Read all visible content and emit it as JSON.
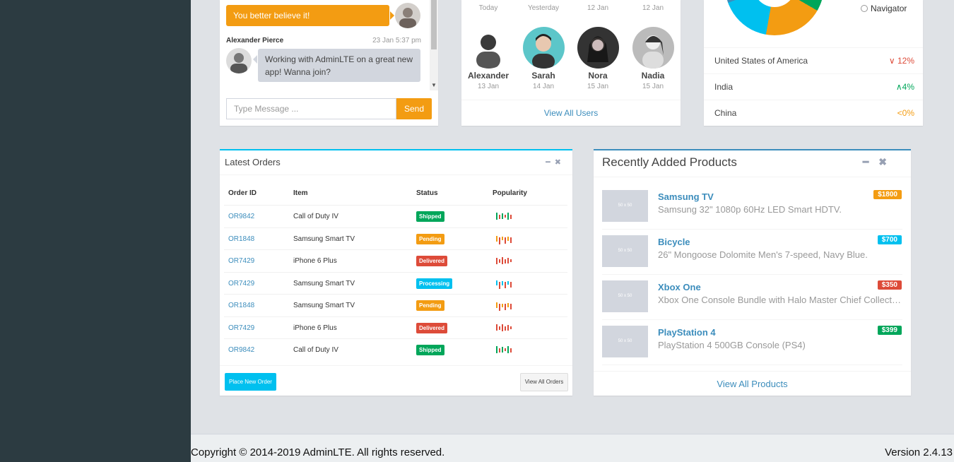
{
  "colors": {
    "sidebar": "#2c3b41",
    "orange": "#f39c12",
    "green": "#00a65a",
    "red": "#dd4b39",
    "aqua": "#00c0ef",
    "blue": "#3c8dbc"
  },
  "chat": {
    "my_message": "You better believe it!",
    "other_name": "Alexander Pierce",
    "other_time": "23 Jan 5:37 pm",
    "other_message": "Working with AdminLTE on a great new app! Wanna join?",
    "input_placeholder": "Type Message ...",
    "send_label": "Send"
  },
  "users": {
    "top_dates": [
      "Today",
      "Yesterday",
      "12 Jan",
      "12 Jan"
    ],
    "list": [
      {
        "name": "Alexander",
        "date": "13 Jan"
      },
      {
        "name": "Sarah",
        "date": "14 Jan"
      },
      {
        "name": "Nora",
        "date": "15 Jan"
      },
      {
        "name": "Nadia",
        "date": "15 Jan"
      }
    ],
    "view_all": "View All Users"
  },
  "countries": {
    "legend_label": "Navigator",
    "rows": [
      {
        "name": "United States of America",
        "pct": "12%",
        "arrow": "∨",
        "color": "#dd4b39"
      },
      {
        "name": "India",
        "pct": "4%",
        "arrow": "∧",
        "color": "#00a65a"
      },
      {
        "name": "China",
        "pct": "0%",
        "arrow": "<",
        "color": "#f39c12"
      }
    ]
  },
  "orders": {
    "title": "Latest Orders",
    "headers": {
      "id": "Order ID",
      "item": "Item",
      "status": "Status",
      "popularity": "Popularity"
    },
    "rows": [
      {
        "id": "OR9842",
        "item": "Call of Duty IV",
        "status": "Shipped",
        "color": "#00a65a"
      },
      {
        "id": "OR1848",
        "item": "Samsung Smart TV",
        "status": "Pending",
        "color": "#f39c12"
      },
      {
        "id": "OR7429",
        "item": "iPhone 6 Plus",
        "status": "Delivered",
        "color": "#dd4b39"
      },
      {
        "id": "OR7429",
        "item": "Samsung Smart TV",
        "status": "Processing",
        "color": "#00c0ef"
      },
      {
        "id": "OR1848",
        "item": "Samsung Smart TV",
        "status": "Pending",
        "color": "#f39c12"
      },
      {
        "id": "OR7429",
        "item": "iPhone 6 Plus",
        "status": "Delivered",
        "color": "#dd4b39"
      },
      {
        "id": "OR9842",
        "item": "Call of Duty IV",
        "status": "Shipped",
        "color": "#00a65a"
      }
    ],
    "place_order": "Place New Order",
    "view_all": "View All Orders"
  },
  "products": {
    "title": "Recently Added Products",
    "placeholder": "50 x 50",
    "items": [
      {
        "name": "Samsung TV",
        "desc": "Samsung 32\" 1080p 60Hz LED Smart HDTV.",
        "price": "$1800",
        "color": "#f39c12"
      },
      {
        "name": "Bicycle",
        "desc": "26\" Mongoose Dolomite Men's 7-speed, Navy Blue.",
        "price": "$700",
        "color": "#00c0ef"
      },
      {
        "name": "Xbox One",
        "desc": "Xbox One Console Bundle with Halo Master Chief Collection.",
        "price": "$350",
        "color": "#dd4b39"
      },
      {
        "name": "PlayStation 4",
        "desc": "PlayStation 4 500GB Console (PS4)",
        "price": "$399",
        "color": "#00a65a"
      }
    ],
    "view_all": "View All Products"
  },
  "footer": {
    "copyright": "Copyright © 2014-2019 AdminLTE. All rights reserved.",
    "version": "Version 2.4.13"
  }
}
